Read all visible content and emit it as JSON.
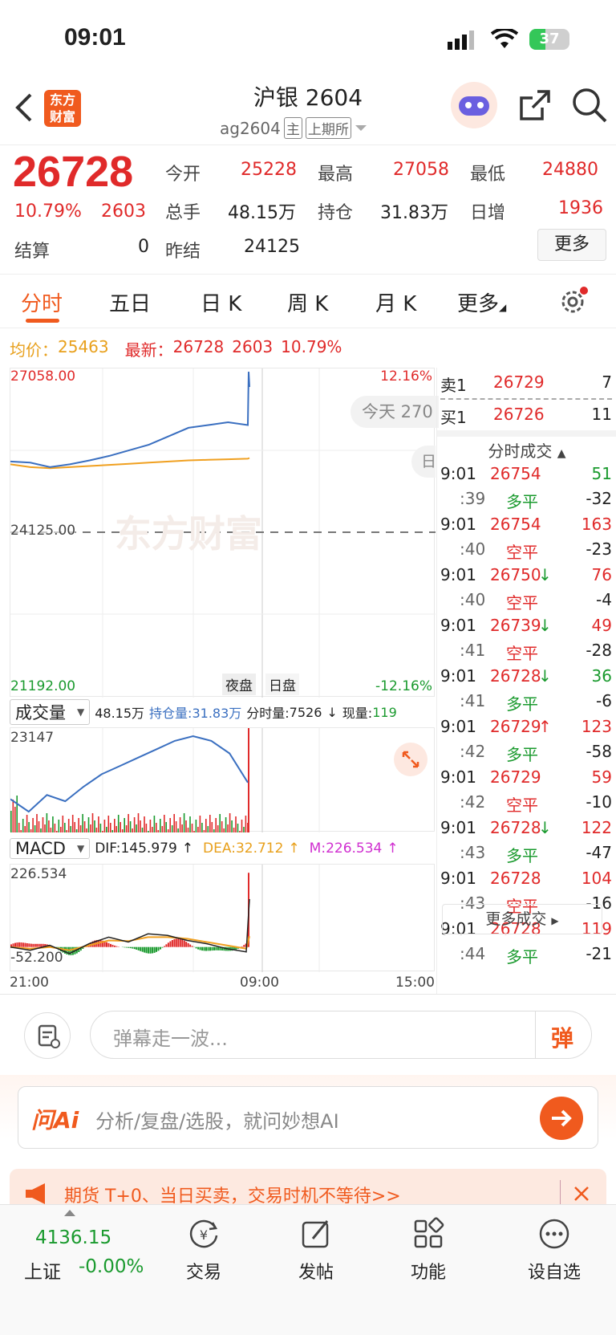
{
  "status_bar": {
    "time": "09:01",
    "battery": "37"
  },
  "header": {
    "logo_line1": "东方",
    "logo_line2": "财富",
    "title": "沪银 2604",
    "code": "ag2604",
    "tag_main": "主",
    "exchange": "上期所"
  },
  "quote": {
    "price": "26728",
    "change_pct": "10.79%",
    "change": "2603",
    "settle_label": "结算",
    "settle": "0",
    "open_label": "今开",
    "open": "25228",
    "high_label": "最高",
    "high": "27058",
    "low_label": "最低",
    "low": "24880",
    "vol_label": "总手",
    "vol": "48.15万",
    "oi_label": "持仓",
    "oi": "31.83万",
    "daily_inc_label": "日增",
    "daily_inc": "1936",
    "prev_settle_label": "昨结",
    "prev_settle": "24125",
    "more_label": "更多"
  },
  "tabs": [
    "分时",
    "五日",
    "日 K",
    "周 K",
    "月 K",
    "更多"
  ],
  "summary": {
    "avg_label": "均价：",
    "avg": "25463",
    "latest_label": "最新：",
    "latest": "26728",
    "latest_change": "2603",
    "latest_pct": "10.79%"
  },
  "chart_labels": {
    "top_price": "27058.00",
    "top_pct": "12.16%",
    "mid_price": "24125.00",
    "bottom_price": "21192.00",
    "bottom_pct": "-12.16%",
    "today_bubble": "今天 270",
    "session_night": "夜盘",
    "session_day": "日盘",
    "watermark": "东方财富",
    "time_start": "21:00",
    "time_mid": "09:00",
    "time_end": "15:00"
  },
  "chart_data": [
    {
      "type": "line",
      "title": "",
      "x": [
        "21:00",
        "09:00",
        "15:00"
      ],
      "ylim": [
        21192,
        27058
      ],
      "series": [
        {
          "name": "price",
          "values": [
            25400,
            25380,
            25300,
            25350,
            25420,
            25500,
            25600,
            25700,
            25850,
            26000,
            26050,
            26100,
            26050,
            26728
          ]
        },
        {
          "name": "avg",
          "values": [
            25350,
            25300,
            25280,
            25300,
            25320,
            25340,
            25360,
            25380,
            25400,
            25420,
            25430,
            25440,
            25450,
            25463
          ]
        }
      ]
    },
    {
      "type": "bar",
      "title": "成交量",
      "ylim": [
        0,
        23147
      ],
      "series": [
        {
          "name": "持仓量",
          "values": [
            8000,
            5000,
            9000,
            7500,
            11000,
            14000,
            16000,
            18000,
            20000,
            22000,
            23147,
            22000,
            19000,
            12000
          ]
        }
      ]
    },
    {
      "type": "line",
      "title": "MACD",
      "ylim": [
        -52.2,
        226.534
      ],
      "series": [
        {
          "name": "DIF",
          "values": [
            0,
            -10,
            5,
            -20,
            10,
            30,
            15,
            40,
            35,
            20,
            10,
            -5,
            -15,
            145.979
          ]
        },
        {
          "name": "DEA",
          "values": [
            0,
            -5,
            0,
            -10,
            5,
            20,
            18,
            30,
            30,
            25,
            15,
            5,
            -5,
            32.712
          ]
        }
      ]
    }
  ],
  "volume_bar": {
    "selector": "成交量",
    "vol": "48.15万",
    "oi_label": "持仓量:",
    "oi": "31.83万",
    "min_vol_label": "分时量:",
    "min_vol": "7526",
    "now_label": "现量:",
    "now": "119",
    "max": "23147"
  },
  "macd_bar": {
    "selector": "MACD",
    "dif_label": "DIF:",
    "dif": "145.979",
    "dea_label": "DEA:",
    "dea": "32.712",
    "m_label": "M:",
    "m": "226.534",
    "max": "226.534",
    "min": "-52.200"
  },
  "order_book": {
    "sell_label": "卖1",
    "sell_price": "26729",
    "sell_qty": "7",
    "buy_label": "买1",
    "buy_price": "26726",
    "buy_qty": "11",
    "trades_title": "分时成交",
    "more_trades": "更多成交"
  },
  "trades": [
    {
      "time": "9:01",
      "price": "26754",
      "arrow": "",
      "vol": "51",
      "sec": ":39",
      "type": "多平",
      "delta": "-32"
    },
    {
      "time": "9:01",
      "price": "26754",
      "arrow": "",
      "vol": "163",
      "sec": ":40",
      "type": "空平",
      "delta": "-23"
    },
    {
      "time": "9:01",
      "price": "26750",
      "arrow": "↓",
      "vol": "76",
      "sec": ":40",
      "type": "空平",
      "delta": "-4"
    },
    {
      "time": "9:01",
      "price": "26739",
      "arrow": "↓",
      "vol": "49",
      "sec": ":41",
      "type": "空平",
      "delta": "-28"
    },
    {
      "time": "9:01",
      "price": "26728",
      "arrow": "↓",
      "vol": "36",
      "sec": ":41",
      "type": "多平",
      "delta": "-6"
    },
    {
      "time": "9:01",
      "price": "26729",
      "arrow": "↑",
      "vol": "123",
      "sec": ":42",
      "type": "多平",
      "delta": "-58"
    },
    {
      "time": "9:01",
      "price": "26729",
      "arrow": "",
      "vol": "59",
      "sec": ":42",
      "type": "空平",
      "delta": "-10"
    },
    {
      "time": "9:01",
      "price": "26728",
      "arrow": "↓",
      "vol": "122",
      "sec": ":43",
      "type": "多平",
      "delta": "-47"
    },
    {
      "time": "9:01",
      "price": "26728",
      "arrow": "",
      "vol": "104",
      "sec": ":43",
      "type": "空平",
      "delta": "-16"
    },
    {
      "time": "9:01",
      "price": "26728",
      "arrow": "",
      "vol": "119",
      "sec": ":44",
      "type": "多平",
      "delta": "-21"
    }
  ],
  "comment": {
    "placeholder": "弹幕走一波...",
    "danmu": "弹"
  },
  "ai": {
    "logo": "问Ai",
    "placeholder": "分析/复盘/选股，就问妙想AI"
  },
  "banner": {
    "text": "期货 T+0、当日买卖，交易时机不等待>>"
  },
  "bottom_nav": {
    "index_value": "4136.15",
    "index_name": "上证",
    "index_change": "-0.00%",
    "trade": "交易",
    "post": "发帖",
    "func": "功能",
    "watch": "设自选"
  }
}
